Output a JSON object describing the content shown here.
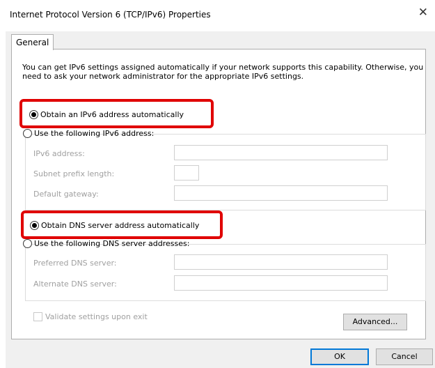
{
  "window": {
    "title": "Internet Protocol Version 6 (TCP/IPv6) Properties",
    "close_glyph": "✕"
  },
  "tabs": [
    "General"
  ],
  "description": "You can get IPv6 settings assigned automatically if your network supports this capability. Otherwise, you need to ask your network administrator for the appropriate IPv6 settings.",
  "ip": {
    "auto_label": "Obtain an IPv6 address automatically",
    "manual_label": "Use the following IPv6 address:",
    "selected": "auto",
    "fields": [
      {
        "label": "IPv6 address:",
        "value": ""
      },
      {
        "label": "Subnet prefix length:",
        "value": ""
      },
      {
        "label": "Default gateway:",
        "value": ""
      }
    ]
  },
  "dns": {
    "auto_label": "Obtain DNS server address automatically",
    "manual_label": "Use the following DNS server addresses:",
    "selected": "auto",
    "fields": [
      {
        "label": "Preferred DNS server:",
        "value": ""
      },
      {
        "label": "Alternate DNS server:",
        "value": ""
      }
    ]
  },
  "validate": {
    "label": "Validate settings upon exit",
    "checked": false
  },
  "buttons": {
    "advanced": "Advanced...",
    "ok": "OK",
    "cancel": "Cancel"
  },
  "colors": {
    "highlight": "#e00000",
    "primary_border": "#0078d7"
  }
}
